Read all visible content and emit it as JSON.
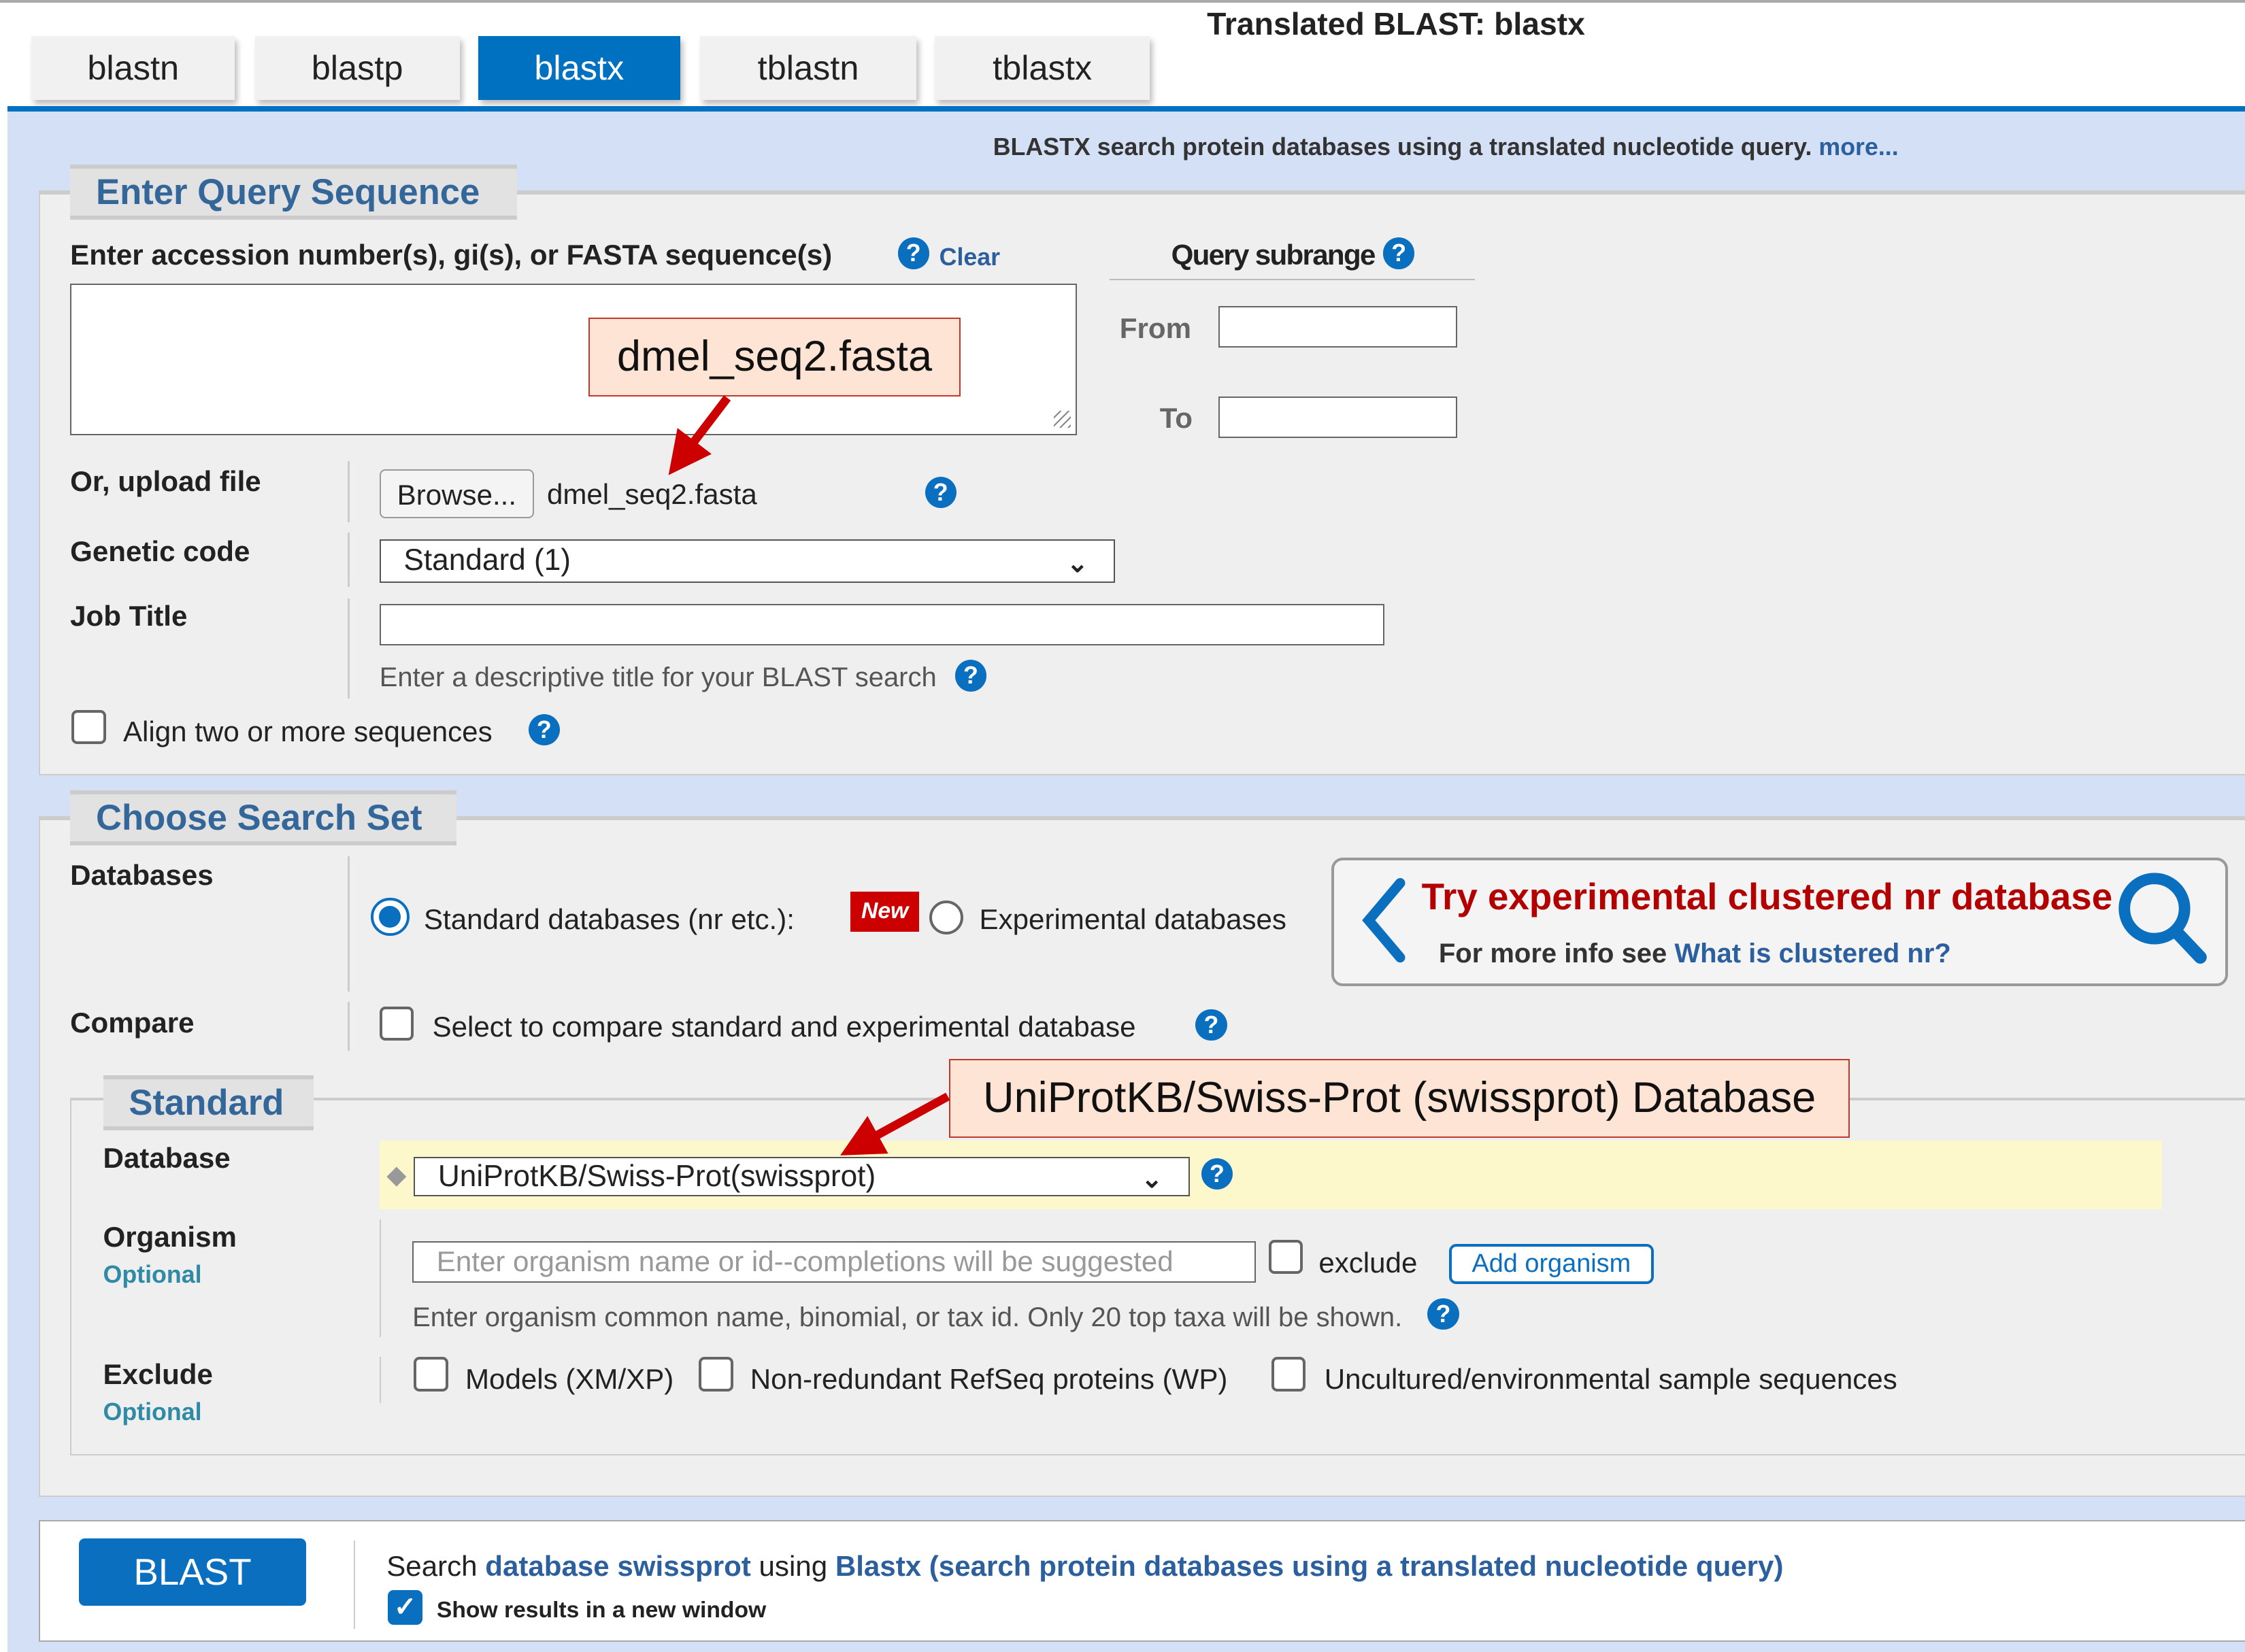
{
  "page_title": "Translated BLAST: blastx",
  "tabs": [
    {
      "label": "blastn",
      "active": false
    },
    {
      "label": "blastp",
      "active": false
    },
    {
      "label": "blastx",
      "active": true
    },
    {
      "label": "tblastn",
      "active": false
    },
    {
      "label": "tblastx",
      "active": false
    }
  ],
  "description": {
    "text": "BLASTX search protein databases using a translated nucleotide query.",
    "more_link": "more..."
  },
  "query_section": {
    "legend": "Enter Query Sequence",
    "accession_label": "Enter accession number(s), gi(s), or FASTA sequence(s)",
    "clear_link": "Clear",
    "textarea_value": "",
    "subrange_label": "Query subrange",
    "from_label": "From",
    "to_label": "To",
    "from_value": "",
    "to_value": "",
    "upload_label": "Or, upload file",
    "browse_button": "Browse...",
    "uploaded_file": "dmel_seq2.fasta",
    "genetic_code_label": "Genetic code",
    "genetic_code_value": "Standard (1)",
    "job_title_label": "Job Title",
    "job_title_value": "",
    "job_title_hint": "Enter a descriptive title for your BLAST search",
    "align_two_label": "Align two or more sequences",
    "align_two_checked": false
  },
  "search_set": {
    "legend": "Choose Search Set",
    "databases_label": "Databases",
    "standard_radio_label": "Standard databases (nr etc.):",
    "standard_selected": true,
    "new_badge": "New",
    "experimental_radio_label": "Experimental databases",
    "promo_title": "Try experimental clustered nr database",
    "promo_text": "For more info see",
    "promo_link": "What is clustered nr?",
    "compare_label": "Compare",
    "compare_text": "Select to compare standard and experimental database",
    "standard_legend": "Standard",
    "database_label": "Database",
    "database_value": "UniProtKB/Swiss-Prot(swissprot)",
    "organism_label": "Organism",
    "optional_label": "Optional",
    "organism_placeholder": "Enter organism name or id--completions will be suggested",
    "exclude_checkbox_label": "exclude",
    "add_organism_button": "Add organism",
    "organism_hint": "Enter organism common name, binomial, or tax id. Only 20 top taxa will be shown.",
    "exclude_label": "Exclude",
    "exclude_options": [
      {
        "label": "Models (XM/XP)",
        "checked": false
      },
      {
        "label": "Non-redundant RefSeq proteins (WP)",
        "checked": false
      },
      {
        "label": "Uncultured/environmental sample sequences",
        "checked": false
      }
    ]
  },
  "submit": {
    "blast_button": "BLAST",
    "search_prefix": "Search",
    "database_link": "database swissprot",
    "using_text": "using",
    "program_link": "Blastx (search protein databases using a translated nucleotide query)",
    "new_window_label": "Show results in a new window",
    "new_window_checked": true
  },
  "annotations": {
    "file_callout": "dmel_seq2.fasta",
    "database_callout": "UniProtKB/Swiss-Prot (swissprot) Database"
  },
  "colors": {
    "accent": "#0070c0",
    "background": "#d4e0f5",
    "annotation_arrow": "#cc0000",
    "promo_title": "#b30000"
  }
}
